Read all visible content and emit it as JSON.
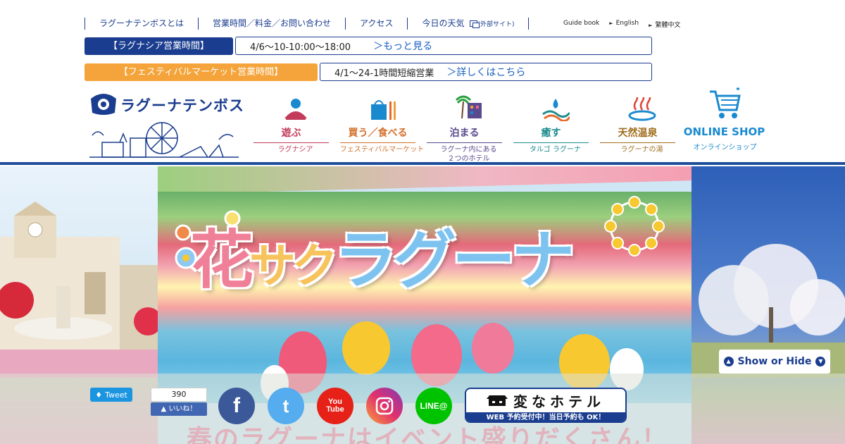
{
  "topnav": {
    "items": [
      "ラグーナテンボスとは",
      "営業時間／料金／お問い合わせ",
      "アクセス",
      "今日の天気"
    ],
    "weather_ext": "(外部サイト)",
    "langs": [
      "Guide book",
      "English",
      "繁體中文"
    ]
  },
  "info": {
    "sia_label": "【ラグナシア営業時間】",
    "sia_text": "4/6～10-10:00～18:00",
    "sia_more": "＞もっと見る",
    "fest_label": "【フェスティバルマーケット営業時間】",
    "fest_text": "4/1～24-1時間短縮営業",
    "fest_more": "＞詳しくはこちら"
  },
  "logo": {
    "text": "ラグーナテンボス"
  },
  "categories": [
    {
      "title": "遊ぶ",
      "sub": "ラグナシア"
    },
    {
      "title": "買う／食べる",
      "sub": "フェスティバルマーケット"
    },
    {
      "title": "泊まる",
      "sub": "ラグーナ内にある",
      "sub2": "２つのホテル"
    },
    {
      "title": "癒す",
      "sub": "タルゴ ラグーナ"
    },
    {
      "title": "天然温泉",
      "sub": "ラグーナの湯"
    },
    {
      "title": "ONLINE SHOP",
      "sub": "オンラインショップ"
    }
  ],
  "hero": {
    "title_hana": "花",
    "title_saku": "サク",
    "title_rest": "ラグーナ",
    "promo": "春のラグーナはイベント盛りだくさん！"
  },
  "showhide": {
    "label": "Show or Hide"
  },
  "social": {
    "tweet": "Tweet",
    "like_count": "390",
    "like_label": "いいね！",
    "fb": "f",
    "tw": "t",
    "yt1": "You",
    "yt2": "Tube",
    "line": "LINE@"
  },
  "hotel": {
    "name": "変なホテル",
    "cta": "WEB 予約受付中！当日予約も OK！"
  },
  "colors": {
    "navy": "#1a3d8f",
    "orange": "#f4a43a",
    "divider": "#1f4e9b"
  }
}
